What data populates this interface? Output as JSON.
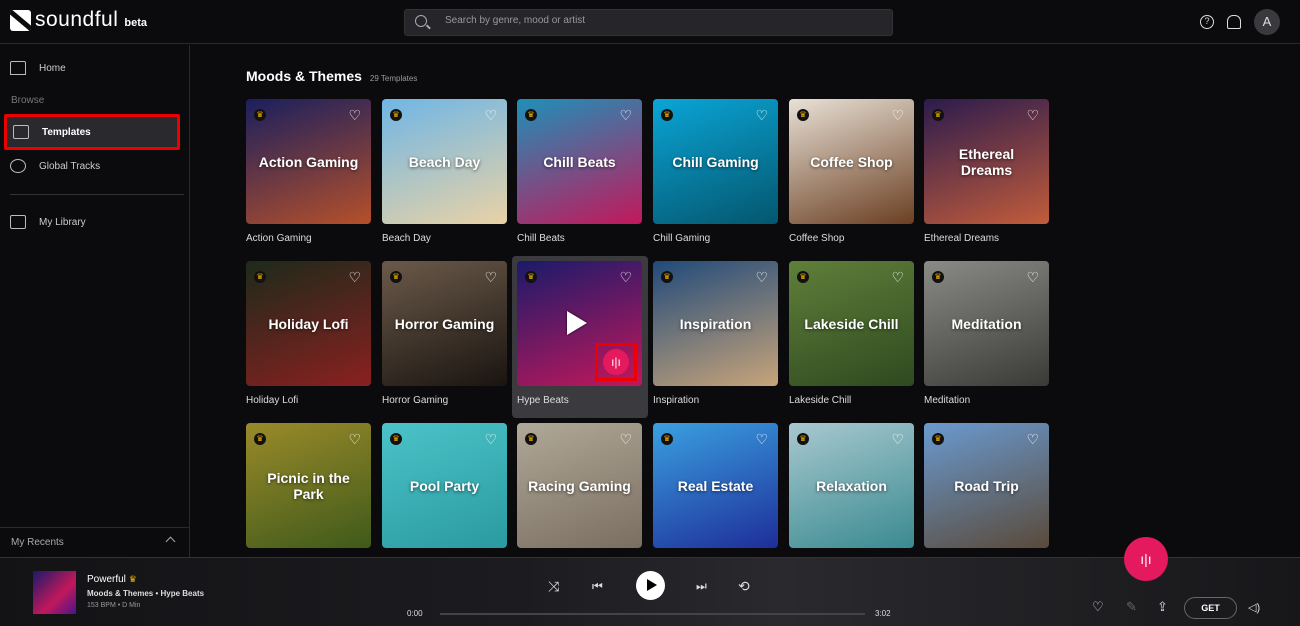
{
  "app": {
    "name": "soundful",
    "badge": "beta"
  },
  "search": {
    "placeholder": "Search by genre, mood or artist"
  },
  "header": {
    "help_icon": "?",
    "avatar": "A"
  },
  "sidebar": {
    "home": "Home",
    "browse": "Browse",
    "templates": "Templates",
    "global_tracks": "Global Tracks",
    "my_library": "My Library",
    "recents": "My Recents"
  },
  "main": {
    "title": "Moods & Themes",
    "count": "29 Templates",
    "cards": [
      {
        "label": "Action Gaming",
        "c1": "#1a1f5e",
        "c2": "#b5502a"
      },
      {
        "label": "Beach Day",
        "c1": "#6fb6e6",
        "c2": "#e9d2a6"
      },
      {
        "label": "Chill Beats",
        "c1": "#1e90b8",
        "c2": "#c2185b"
      },
      {
        "label": "Chill Gaming",
        "c1": "#0aa5d6",
        "c2": "#04566e"
      },
      {
        "label": "Coffee Shop",
        "c1": "#e8e1d6",
        "c2": "#6b3f22"
      },
      {
        "label": "Ethereal Dreams",
        "c1": "#2b1b4d",
        "c2": "#c25c3b"
      },
      {
        "label": "Holiday Lofi",
        "c1": "#1d2a1a",
        "c2": "#8a2020"
      },
      {
        "label": "Horror Gaming",
        "c1": "#6b5a4a",
        "c2": "#1a1410"
      },
      {
        "label": "Hype Beats",
        "c1": "#1a1a6a",
        "c2": "#c2185b"
      },
      {
        "label": "Inspiration",
        "c1": "#204a7a",
        "c2": "#c8a47a"
      },
      {
        "label": "Lakeside Chill",
        "c1": "#5f7f3a",
        "c2": "#2e4a1f"
      },
      {
        "label": "Meditation",
        "c1": "#8a8a86",
        "c2": "#3a3a36"
      },
      {
        "label": "Picnic in the Park",
        "c1": "#9a8a2a",
        "c2": "#3f5a1a"
      },
      {
        "label": "Pool Party",
        "c1": "#4bc3c8",
        "c2": "#2a9aa0"
      },
      {
        "label": "Racing Gaming",
        "c1": "#b0a898",
        "c2": "#7a6e60"
      },
      {
        "label": "Real Estate",
        "c1": "#3aa0e0",
        "c2": "#1e2e9a"
      },
      {
        "label": "Relaxation",
        "c1": "#a8c8d0",
        "c2": "#3a8a90"
      },
      {
        "label": "Road Trip",
        "c1": "#6a9ad0",
        "c2": "#5a4a3a"
      }
    ]
  },
  "player": {
    "title": "Powerful",
    "subtitle": "Moods & Themes • Hype Beats",
    "meta": "153 BPM • D Min",
    "elapsed": "0:00",
    "duration": "3:02",
    "get": "GET",
    "progress": 0
  },
  "colors": {
    "accent": "#e5195e",
    "highlight": "#e00000",
    "crown": "#f4b400"
  }
}
